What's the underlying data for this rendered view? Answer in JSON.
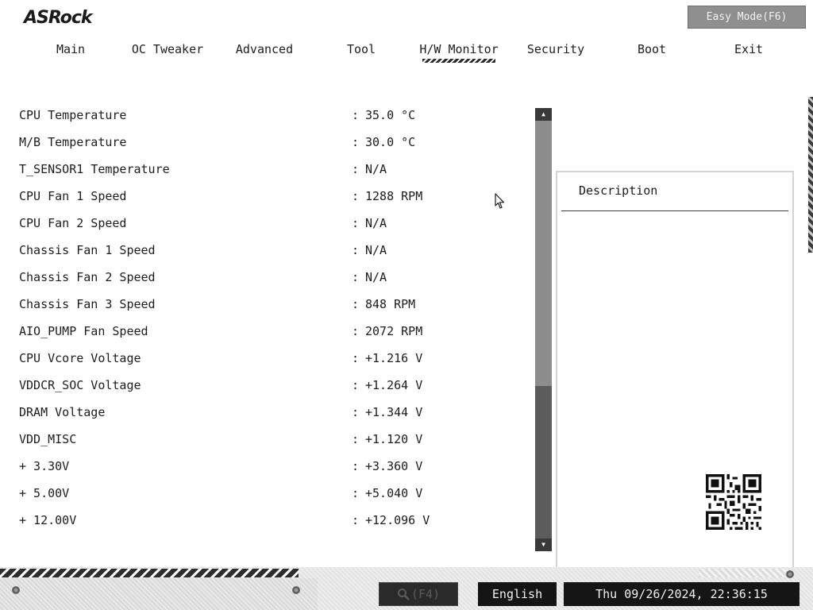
{
  "header": {
    "logo": "ASRock",
    "easy_mode_label": "Easy Mode(F6)"
  },
  "tabs": [
    {
      "label": "Main"
    },
    {
      "label": "OC Tweaker"
    },
    {
      "label": "Advanced"
    },
    {
      "label": "Tool"
    },
    {
      "label": "H/W Monitor",
      "active": true
    },
    {
      "label": "Security"
    },
    {
      "label": "Boot"
    },
    {
      "label": "Exit"
    }
  ],
  "hw": [
    {
      "label": "CPU Temperature",
      "value": "35.0 °C"
    },
    {
      "label": "M/B Temperature",
      "value": "30.0 °C"
    },
    {
      "label": "T_SENSOR1 Temperature",
      "value": "N/A"
    },
    {
      "label": "CPU Fan 1 Speed",
      "value": "1288 RPM"
    },
    {
      "label": "CPU Fan 2 Speed",
      "value": "N/A"
    },
    {
      "label": "Chassis Fan 1 Speed",
      "value": "N/A"
    },
    {
      "label": "Chassis Fan 2 Speed",
      "value": "N/A"
    },
    {
      "label": "Chassis Fan 3 Speed",
      "value": "848 RPM"
    },
    {
      "label": "AIO_PUMP Fan Speed",
      "value": "2072 RPM"
    },
    {
      "label": "CPU Vcore Voltage",
      "value": "+1.216 V"
    },
    {
      "label": "VDDCR_SOC Voltage",
      "value": "+1.264 V"
    },
    {
      "label": "DRAM Voltage",
      "value": "+1.344 V"
    },
    {
      "label": "VDD_MISC",
      "value": "+1.120 V"
    },
    {
      "label": "+ 3.30V",
      "value": "+3.360 V"
    },
    {
      "label": "+ 5.00V",
      "value": "+5.040 V"
    },
    {
      "label": "+ 12.00V",
      "value": "+12.096 V"
    }
  ],
  "separator": ":",
  "description": {
    "title": "Description"
  },
  "footer": {
    "search_label": "(F4)",
    "language": "English",
    "datetime": "Thu 09/26/2024, 22:36:15"
  },
  "icons": {
    "search": "search-icon",
    "scroll_up": "arrow-up-icon",
    "scroll_down": "arrow-down-icon",
    "qr": "qr-code-icon",
    "cursor": "mouse-pointer-icon"
  },
  "colors": {
    "background": "#ffffff",
    "text": "#1c1c1c",
    "footer_button": "#151515",
    "easy_mode_button": "#8f8f8f",
    "scroll_track": "#5c5c5c",
    "scroll_thumb": "#8d8d8d"
  }
}
